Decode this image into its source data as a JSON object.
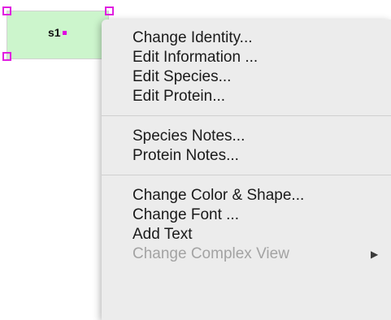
{
  "species_node": {
    "label": "s1",
    "fill_color": "#ccf5cc",
    "selection_color": "#e01ee0"
  },
  "context_menu": {
    "groups": [
      [
        {
          "label": "Change Identity...",
          "enabled": true
        },
        {
          "label": "Edit Information ...",
          "enabled": true
        },
        {
          "label": "Edit Species...",
          "enabled": true
        },
        {
          "label": "Edit Protein...",
          "enabled": true
        }
      ],
      [
        {
          "label": "Species Notes...",
          "enabled": true
        },
        {
          "label": "Protein Notes...",
          "enabled": true
        }
      ],
      [
        {
          "label": "Change Color & Shape...",
          "enabled": true
        },
        {
          "label": "Change Font ...",
          "enabled": true
        },
        {
          "label": "Add Text",
          "enabled": true
        },
        {
          "label": "Change Complex View",
          "enabled": false,
          "submenu": true
        }
      ]
    ],
    "submenu_arrow": "▶"
  }
}
